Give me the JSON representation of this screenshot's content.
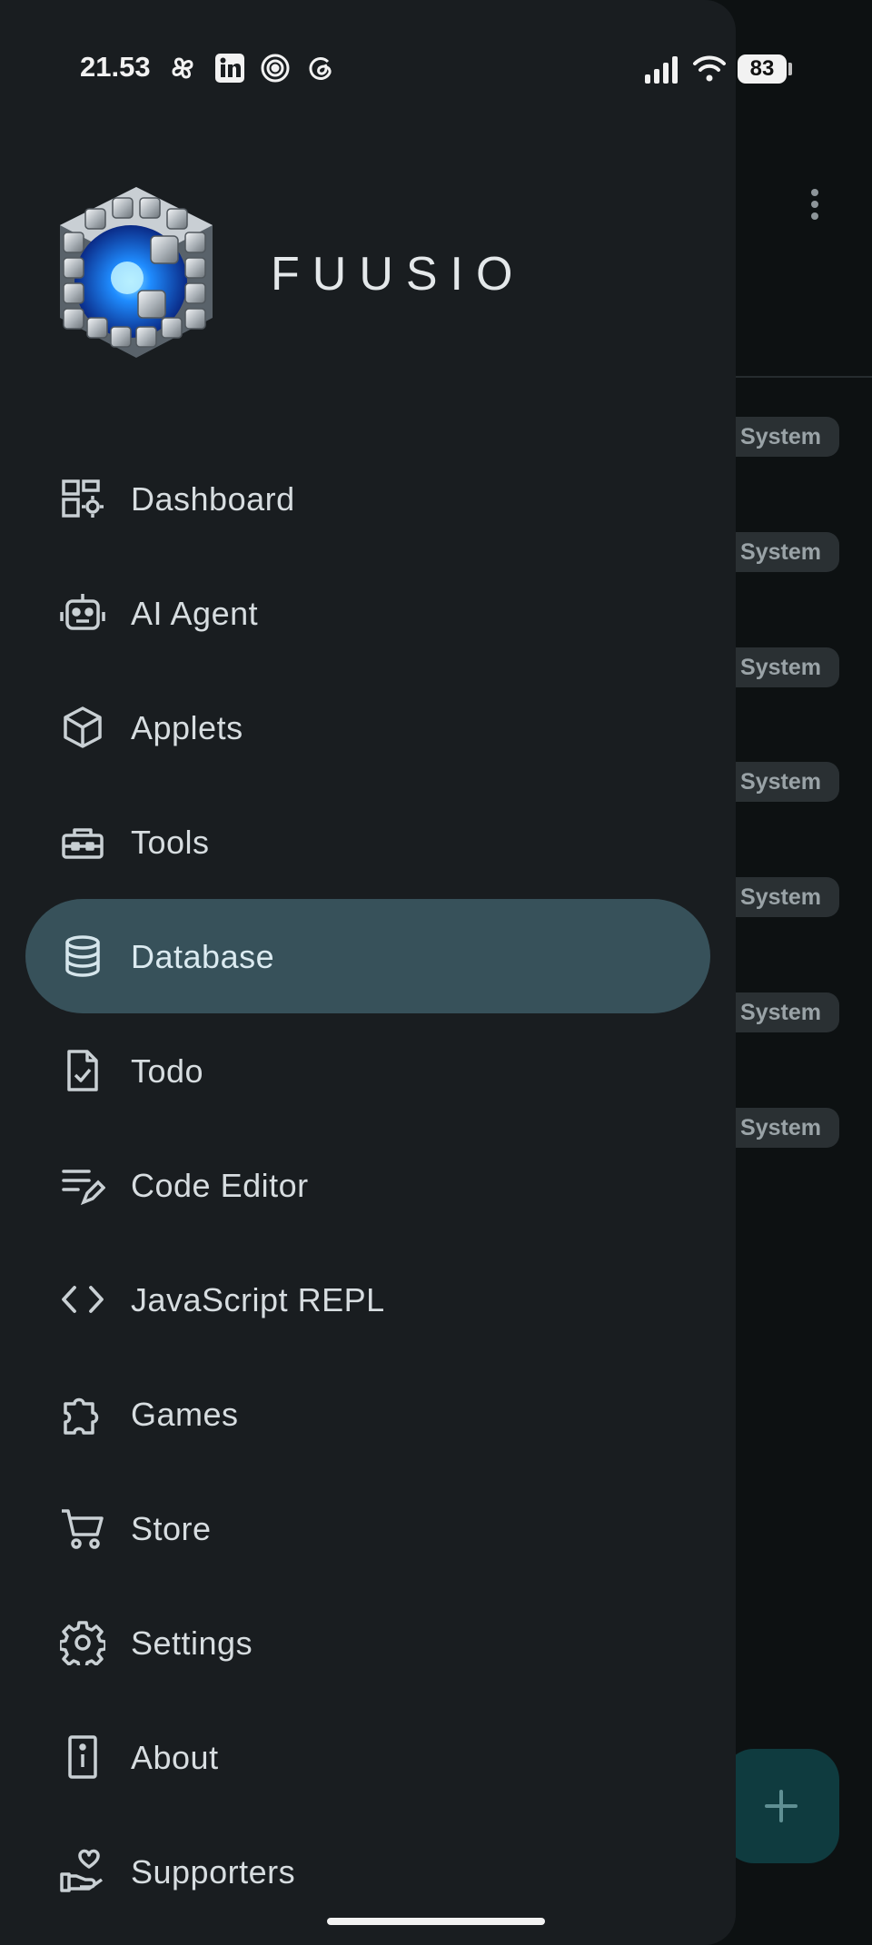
{
  "status_bar": {
    "time": "21.53",
    "battery": "83",
    "icons": [
      "pinwheel-icon",
      "linkedin-icon",
      "threads-like-spiral-icon",
      "threads-icon",
      "signal-icon",
      "wifi-icon"
    ]
  },
  "drawer": {
    "brand": "FUUSIO",
    "items": [
      {
        "label": "Dashboard",
        "icon": "dashboard-icon"
      },
      {
        "label": "AI Agent",
        "icon": "robot-icon"
      },
      {
        "label": "Applets",
        "icon": "cube-icon"
      },
      {
        "label": "Tools",
        "icon": "toolbox-icon"
      },
      {
        "label": "Database",
        "icon": "database-icon",
        "active": true
      },
      {
        "label": "Todo",
        "icon": "task-file-icon"
      },
      {
        "label": "Code Editor",
        "icon": "edit-note-icon"
      },
      {
        "label": "JavaScript REPL",
        "icon": "code-brackets-icon"
      },
      {
        "label": "Games",
        "icon": "puzzle-icon"
      },
      {
        "label": "Store",
        "icon": "cart-icon"
      },
      {
        "label": "Settings",
        "icon": "gear-icon"
      },
      {
        "label": "About",
        "icon": "info-icon"
      },
      {
        "label": "Supporters",
        "icon": "hand-heart-icon"
      }
    ]
  },
  "background": {
    "badges": [
      "System",
      "System",
      "System",
      "System",
      "System",
      "System",
      "System"
    ],
    "fab_icon": "plus-icon",
    "menu_icon": "more-vertical-icon"
  },
  "colors": {
    "drawer_bg": "#191d20",
    "active_item_bg": "#37515a",
    "badge_bg": "#2a3033",
    "fab_bg": "#0f3b3f"
  }
}
